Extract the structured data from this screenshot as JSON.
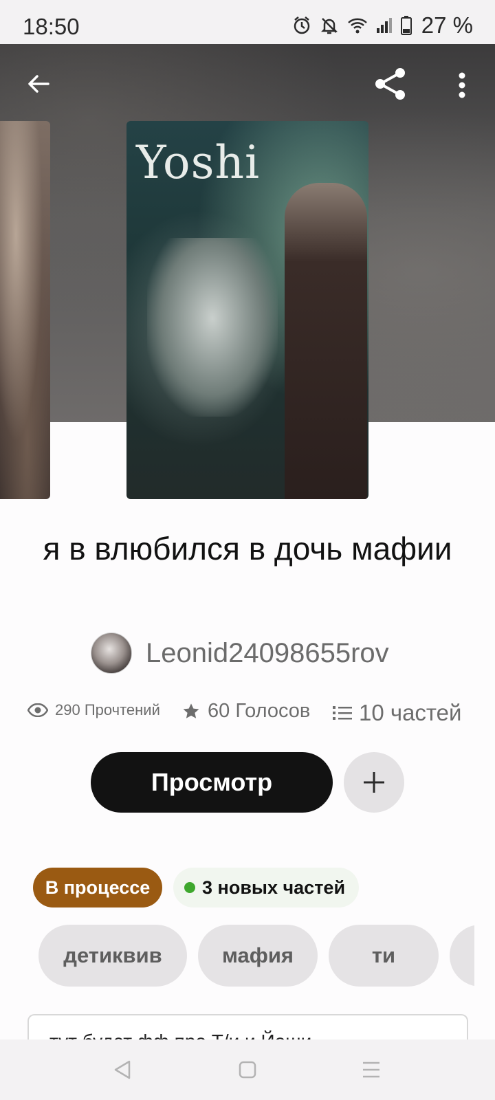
{
  "status_bar": {
    "time": "18:50",
    "battery": "27 %",
    "icons": [
      "alarm-icon",
      "bell-off-icon",
      "wifi-icon",
      "signal-icon",
      "battery-icon"
    ]
  },
  "header": {
    "back_icon": "arrow-left-icon",
    "share_icon": "share-icon",
    "more_icon": "more-vertical-icon"
  },
  "cover": {
    "title_text": "Yoshi"
  },
  "story": {
    "title": "я в влюбился в дочь мафии",
    "author": "Leonid24098655rov"
  },
  "stats": {
    "reads": "290 Прочтений",
    "votes": "60 Голосов",
    "parts": "10 частей"
  },
  "actions": {
    "read_label": "Просмотр",
    "add_icon": "plus-icon"
  },
  "badges": {
    "status": "В процессе",
    "new_parts": "3 новых частей"
  },
  "tags": [
    "детиквив",
    "мафия",
    "ти"
  ],
  "description": {
    "text": "тут будет фф про Т/и и Йоши"
  },
  "colors": {
    "primary_button": "#121212",
    "status_badge": "#9a5a12",
    "new_dot": "#3ea72d"
  }
}
